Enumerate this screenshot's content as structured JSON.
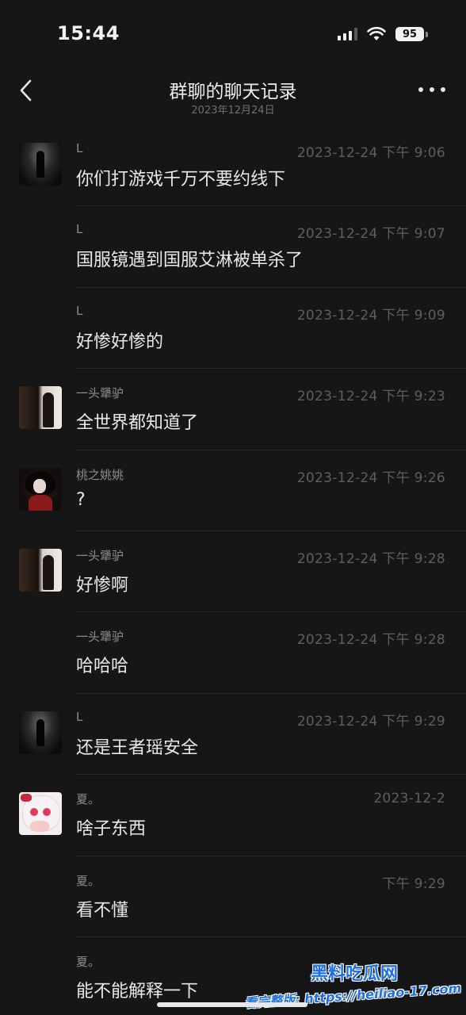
{
  "status_bar": {
    "time": "15:44",
    "battery": "95",
    "icons": [
      "signal-icon",
      "wifi-icon",
      "battery-icon"
    ]
  },
  "nav": {
    "title": "群聊的聊天记录",
    "subtitle": "2023年12月24日",
    "back_icon": "chevron-left-icon",
    "more_icon": "more-dots-icon"
  },
  "messages": [
    {
      "sender": "L",
      "time": "2023-12-24 下午 9:06",
      "content": "你们打游戏千万不要约线下",
      "avatar": "dark"
    },
    {
      "sender": "L",
      "time": "2023-12-24 下午 9:07",
      "content": "国服镜遇到国服艾淋被单杀了",
      "avatar": ""
    },
    {
      "sender": "L",
      "time": "2023-12-24 下午 9:09",
      "content": "好惨好惨的",
      "avatar": ""
    },
    {
      "sender": "一头犟驴",
      "time": "2023-12-24 下午 9:23",
      "content": "全世界都知道了",
      "avatar": "door"
    },
    {
      "sender": "桃之姚姚",
      "time": "2023-12-24 下午 9:26",
      "content": "?",
      "avatar": "girl"
    },
    {
      "sender": "一头犟驴",
      "time": "2023-12-24 下午 9:28",
      "content": "好惨啊",
      "avatar": "door"
    },
    {
      "sender": "一头犟驴",
      "time": "2023-12-24 下午 9:28",
      "content": "哈哈哈",
      "avatar": ""
    },
    {
      "sender": "L",
      "time": "2023-12-24 下午 9:29",
      "content": "还是王者瑶安全",
      "avatar": "dark"
    },
    {
      "sender": "夏。",
      "time": "2023-12-2",
      "content": "啥子东西",
      "avatar": "anime"
    },
    {
      "sender": "夏。",
      "time": "下午 9:29",
      "content": "看不懂",
      "avatar": ""
    },
    {
      "sender": "夏。",
      "time": "",
      "content": "能不能解释一下",
      "avatar": ""
    }
  ],
  "watermark": {
    "logo": "黑料吃瓜网",
    "url": "看完整版: https://heiliao-17.com"
  }
}
